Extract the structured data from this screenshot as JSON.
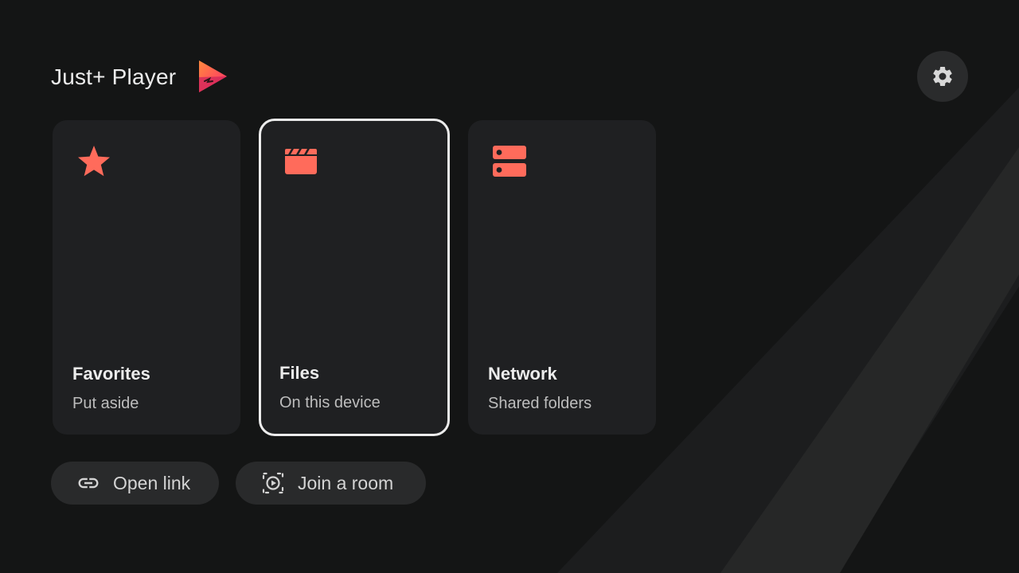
{
  "app": {
    "title": "Just+ Player",
    "accent_color": "#ff6b5b"
  },
  "header": {
    "settings_icon": "gear-icon"
  },
  "cards": [
    {
      "title": "Favorites",
      "subtitle": "Put aside",
      "icon": "star-icon",
      "focused": false
    },
    {
      "title": "Files",
      "subtitle": "On this device",
      "icon": "clapperboard-icon",
      "focused": true
    },
    {
      "title": "Network",
      "subtitle": "Shared folders",
      "icon": "server-icon",
      "focused": false
    }
  ],
  "actions": [
    {
      "label": "Open link",
      "icon": "link-icon"
    },
    {
      "label": "Join a room",
      "icon": "room-play-icon"
    }
  ]
}
